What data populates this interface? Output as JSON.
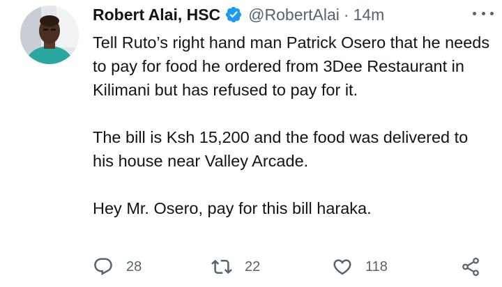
{
  "tweet": {
    "author": {
      "display_name": "Robert Alai, HSC",
      "handle": "@RobertAlai",
      "separator": "·",
      "time": "14m",
      "verified": true
    },
    "paragraphs": [
      "Tell Ruto’s right hand man Patrick Osero that he needs to pay for food he ordered from 3Dee Restaurant in Kilimani but has refused to pay for it.",
      "The bill is Ksh 15,200 and the food was delivered to his house near Valley Arcade.",
      "Hey Mr. Osero, pay for this bill haraka."
    ],
    "actions": {
      "reply_count": "28",
      "retweet_count": "22",
      "like_count": "118"
    }
  },
  "icons": {
    "more": "more-horizontal-icon",
    "reply": "reply-icon",
    "retweet": "retweet-icon",
    "like": "heart-icon",
    "share": "share-icon",
    "verified": "verified-badge-icon"
  },
  "colors": {
    "text": "#0f1419",
    "secondary": "#536471",
    "verified": "#1d9bf0"
  }
}
